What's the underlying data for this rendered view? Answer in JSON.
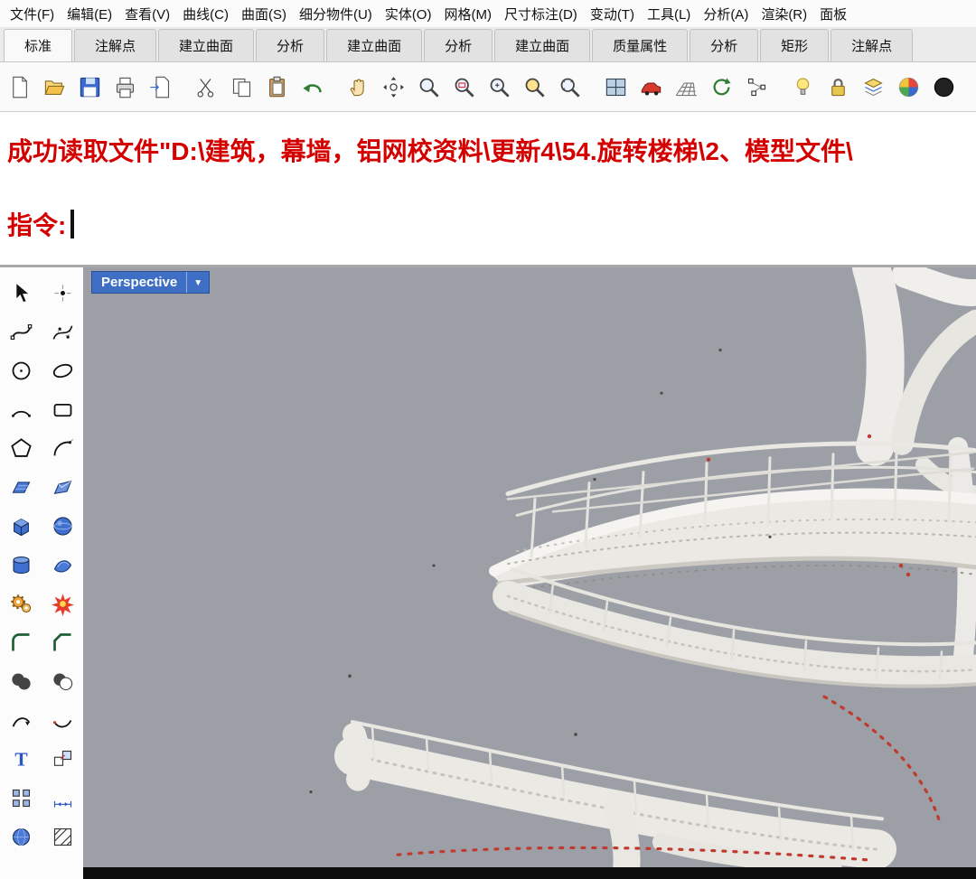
{
  "menubar": {
    "items": [
      {
        "label": "文件(F)"
      },
      {
        "label": "编辑(E)"
      },
      {
        "label": "查看(V)"
      },
      {
        "label": "曲线(C)"
      },
      {
        "label": "曲面(S)"
      },
      {
        "label": "细分物件(U)"
      },
      {
        "label": "实体(O)"
      },
      {
        "label": "网格(M)"
      },
      {
        "label": "尺寸标注(D)"
      },
      {
        "label": "变动(T)"
      },
      {
        "label": "工具(L)"
      },
      {
        "label": "分析(A)"
      },
      {
        "label": "渲染(R)"
      },
      {
        "label": "面板"
      }
    ]
  },
  "tabbar": {
    "tabs": [
      {
        "label": "标准",
        "active": true
      },
      {
        "label": "注解点",
        "active": false
      },
      {
        "label": "建立曲面",
        "active": false
      },
      {
        "label": "分析",
        "active": false
      },
      {
        "label": "建立曲面",
        "active": false
      },
      {
        "label": "分析",
        "active": false
      },
      {
        "label": "建立曲面",
        "active": false
      },
      {
        "label": "质量属性",
        "active": false
      },
      {
        "label": "分析",
        "active": false
      },
      {
        "label": "矩形",
        "active": false
      },
      {
        "label": "注解点",
        "active": false
      }
    ]
  },
  "toolbar": {
    "icons": [
      "new-file",
      "open-file",
      "save",
      "print",
      "export-page",
      "cut",
      "copy",
      "paste",
      "undo",
      "pan",
      "rotate-view",
      "zoom",
      "zoom-window",
      "zoom-dynamic",
      "zoom-selected",
      "zoom-extents",
      "four-viewports",
      "named-view-car",
      "cplane-grid",
      "view-rotate",
      "object-snap",
      "lamp",
      "lock",
      "layers",
      "color-wheel",
      "display-mode"
    ]
  },
  "command_area": {
    "history_line": "成功读取文件\"D:\\建筑，幕墙，铝网校资料\\更新4\\54.旋转楼梯\\2、模型文件\\",
    "prompt_label": "指令:"
  },
  "sidebar": {
    "icons": [
      "select-arrow",
      "point",
      "curve-interpolate",
      "curve-control",
      "circle",
      "ellipse",
      "arc",
      "rectangle-rounded",
      "polygon",
      "arc-handle",
      "surface-plane",
      "surface-corner",
      "box",
      "sphere",
      "cylinder",
      "surface-patch",
      "gears",
      "burst",
      "fillet",
      "chamfer",
      "boolean-union",
      "boolean-difference",
      "curve-tool",
      "curve-tool-2",
      "text",
      "move-copy",
      "array-squares",
      "dimension",
      "sphere-blue",
      "hatch"
    ]
  },
  "viewport": {
    "title": "Perspective",
    "dropdown_glyph": "▼",
    "content_description": "point cloud of spiral staircase"
  },
  "colors": {
    "command_text": "#d40000",
    "viewport_background": "#9ca0a6",
    "viewport_title_background": "#3f6fc5",
    "point_cloud": "#ebe9e4",
    "red_markers": "#c03a30"
  }
}
